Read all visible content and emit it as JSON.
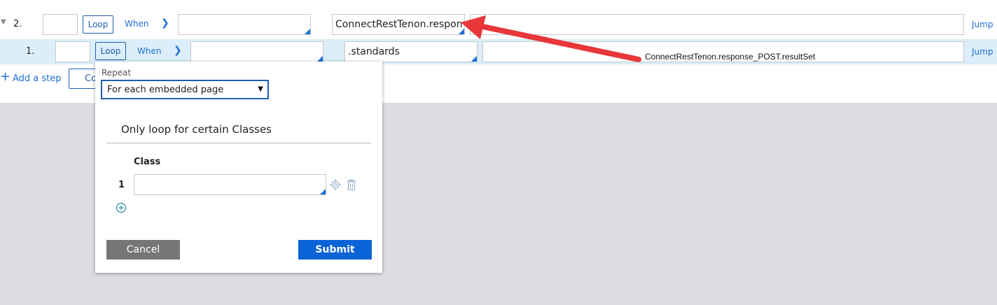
{
  "rows": [
    {
      "number": "2.",
      "loop_label": "Loop",
      "when_label": "When",
      "step_value": "ConnectRestTenon.respons",
      "jump_label": "Jump"
    },
    {
      "number": "1.",
      "loop_label": "Loop",
      "when_label": "When",
      "step_value": ".standards",
      "jump_label": "Jump"
    }
  ],
  "add_step_label": "Add a step",
  "partial_button_label": "Co",
  "popup": {
    "repeat_label": "Repeat",
    "repeat_value": "For each embedded page",
    "section_title": "Only loop for certain Classes",
    "class_header": "Class",
    "class_rows": [
      {
        "index": "1",
        "value": ""
      }
    ],
    "cancel_label": "Cancel",
    "submit_label": "Submit"
  },
  "annotation": {
    "text": "ConnectRestTenon.response_POST.resultSet",
    "arrow_color": "#e8373a"
  },
  "colors": {
    "accent": "#1f5fb0",
    "submit": "#0b63d8",
    "cancel": "#767676",
    "row_highlight": "#dbeef9",
    "backdrop": "#dcdde1"
  }
}
